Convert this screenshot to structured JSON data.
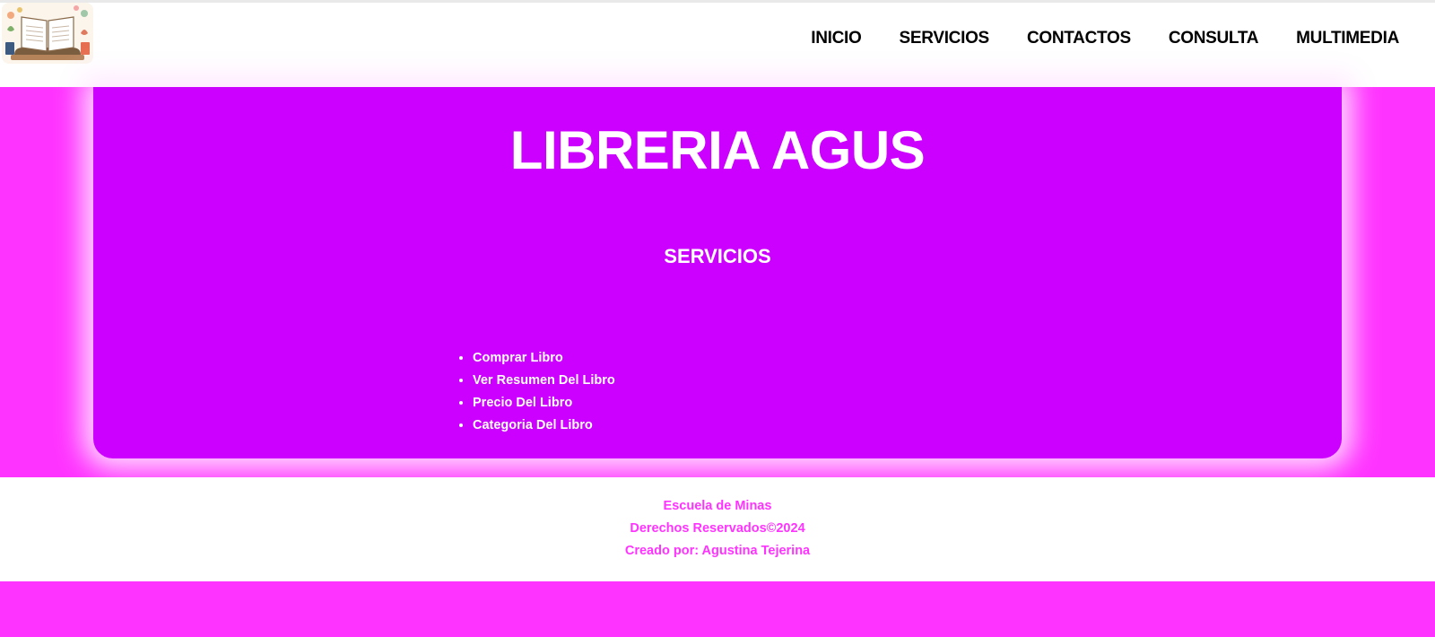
{
  "nav": {
    "items": [
      "INICIO",
      "SERVICIOS",
      "CONTACTOS",
      "CONSULTA",
      "MULTIMEDIA"
    ]
  },
  "hero": {
    "title": "LIBRERIA AGUS",
    "section_title": "SERVICIOS",
    "services": [
      "Comprar Libro",
      "Ver Resumen Del Libro",
      "Precio Del Libro",
      "Categoria Del Libro"
    ]
  },
  "footer": {
    "line1": "Escuela de Minas",
    "line2": "Derechos Reservados©2024",
    "line3": "Creado por: Agustina Tejerina"
  },
  "colors": {
    "page_pink": "#ff33ff",
    "card_purple": "#cc00ff",
    "footer_text": "#ff33ff",
    "nav_text": "#000000"
  },
  "icons": {
    "logo": "open-book-logo"
  }
}
